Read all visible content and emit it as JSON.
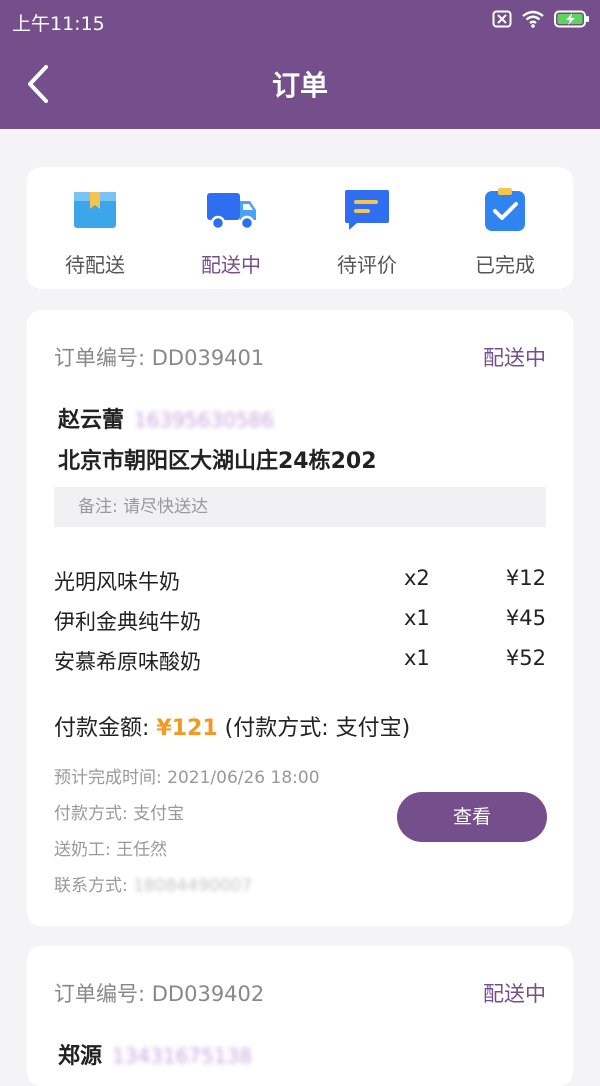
{
  "status_bar": {
    "time": "上午11:15"
  },
  "header": {
    "title": "订单"
  },
  "tabs": [
    {
      "label": "待配送"
    },
    {
      "label": "配送中"
    },
    {
      "label": "待评价"
    },
    {
      "label": "已完成"
    }
  ],
  "colors": {
    "brand": "#744f8b",
    "accent_price": "#f39a26"
  },
  "orders": [
    {
      "order_no": "订单编号: DD039401",
      "status": "配送中",
      "name": "赵云蕾",
      "phone": "16395630586",
      "address": "北京市朝阳区大湖山庄24栋202",
      "remark": "备注: 请尽快送达",
      "items": [
        {
          "name": "光明风味牛奶",
          "qty": "x2",
          "price": "¥12"
        },
        {
          "name": "伊利金典纯牛奶",
          "qty": "x1",
          "price": "¥45"
        },
        {
          "name": "安慕希原味酸奶",
          "qty": "x1",
          "price": "¥52"
        }
      ],
      "pay_label": "付款金额: ",
      "pay_amount": "¥121",
      "pay_method_note": " (付款方式: 支付宝)",
      "eta": "预计完成时间: 2021/06/26 18:00",
      "pay_method": "付款方式: 支付宝",
      "courier": "送奶工: 王任然",
      "contact_label": "联系方式: ",
      "contact_value": "18084490007",
      "view_label": "查看"
    },
    {
      "order_no": "订单编号: DD039402",
      "status": "配送中",
      "name": "郑源",
      "phone": "13431675138"
    }
  ]
}
